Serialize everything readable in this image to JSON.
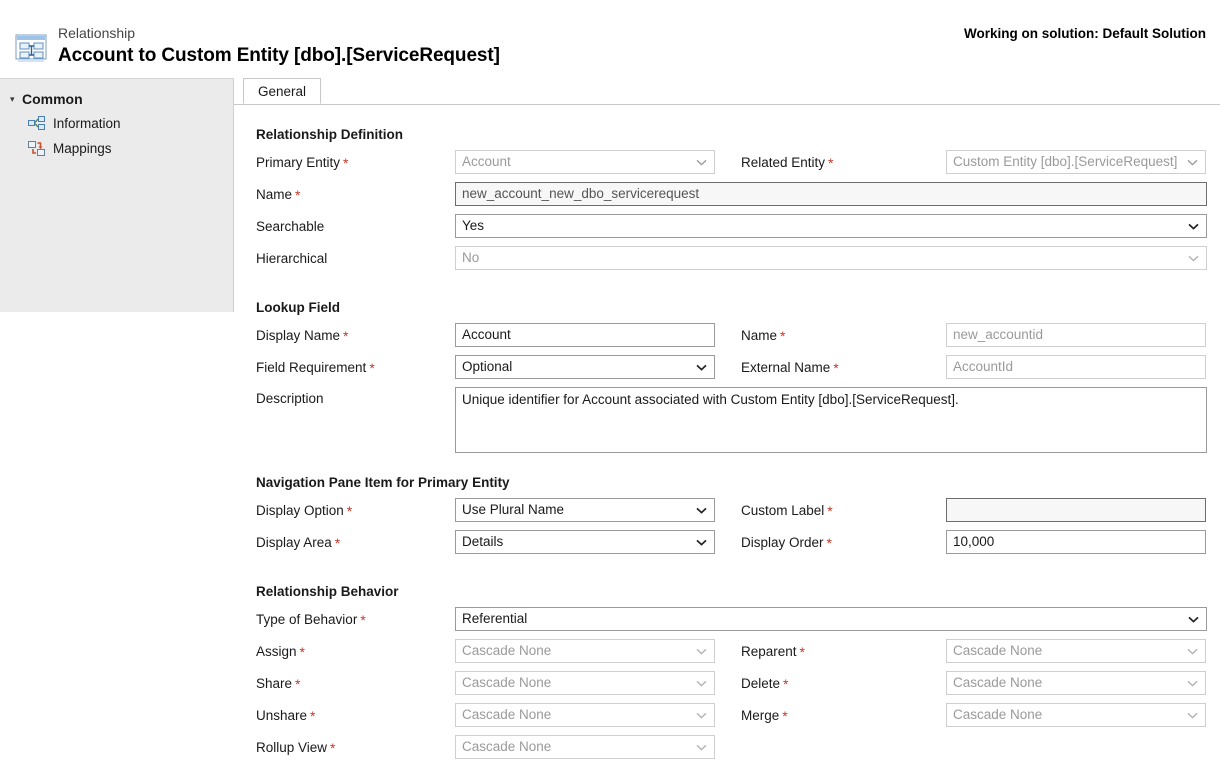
{
  "header": {
    "kicker": "Relationship",
    "title": "Account to Custom Entity [dbo].[ServiceRequest]",
    "solution_note": "Working on solution: Default Solution",
    "icon": "relationship-icon"
  },
  "sidebar": {
    "group_label": "Common",
    "group_icon": "triangle-collapse-icon",
    "items": [
      {
        "label": "Information",
        "icon": "information-relationship-icon"
      },
      {
        "label": "Mappings",
        "icon": "mappings-icon"
      }
    ]
  },
  "tabs": [
    {
      "label": "General",
      "active": true
    }
  ],
  "sections": {
    "relationship_definition": {
      "title": "Relationship Definition",
      "primary_entity": {
        "label": "Primary Entity",
        "required": true,
        "value": "Account",
        "disabled": true,
        "control": "dropdown"
      },
      "related_entity": {
        "label": "Related Entity",
        "required": true,
        "value": "Custom Entity [dbo].[ServiceRequest]",
        "disabled": true,
        "control": "dropdown"
      },
      "name": {
        "label": "Name",
        "required": true,
        "value": "new_account_new_dbo_servicerequest",
        "readonly": true,
        "control": "text"
      },
      "searchable": {
        "label": "Searchable",
        "required": false,
        "value": "Yes",
        "disabled": false,
        "control": "dropdown"
      },
      "hierarchical": {
        "label": "Hierarchical",
        "required": false,
        "value": "No",
        "disabled": true,
        "control": "dropdown"
      }
    },
    "lookup_field": {
      "title": "Lookup Field",
      "display_name": {
        "label": "Display Name",
        "required": true,
        "value": "Account",
        "disabled": false,
        "control": "text"
      },
      "name": {
        "label": "Name",
        "required": true,
        "value": "new_accountid",
        "disabled": true,
        "control": "text"
      },
      "field_requirement": {
        "label": "Field Requirement",
        "required": true,
        "value": "Optional",
        "disabled": false,
        "control": "dropdown"
      },
      "external_name": {
        "label": "External Name",
        "required": true,
        "value": "AccountId",
        "disabled": true,
        "control": "text"
      },
      "description": {
        "label": "Description",
        "required": false,
        "value": "Unique identifier for Account associated with Custom Entity [dbo].[ServiceRequest].",
        "control": "textarea"
      }
    },
    "navigation_pane": {
      "title": "Navigation Pane Item for Primary Entity",
      "display_option": {
        "label": "Display Option",
        "required": true,
        "value": "Use Plural Name",
        "disabled": false,
        "control": "dropdown"
      },
      "custom_label": {
        "label": "Custom Label",
        "required": true,
        "value": "",
        "readonly": true,
        "control": "text"
      },
      "display_area": {
        "label": "Display Area",
        "required": true,
        "value": "Details",
        "disabled": false,
        "control": "dropdown"
      },
      "display_order": {
        "label": "Display Order",
        "required": true,
        "value": "10,000",
        "disabled": false,
        "control": "text"
      }
    },
    "relationship_behavior": {
      "title": "Relationship Behavior",
      "type_of_behavior": {
        "label": "Type of Behavior",
        "required": true,
        "value": "Referential",
        "disabled": false,
        "control": "dropdown"
      },
      "assign": {
        "label": "Assign",
        "required": true,
        "value": "Cascade None",
        "disabled": true,
        "control": "dropdown"
      },
      "reparent": {
        "label": "Reparent",
        "required": true,
        "value": "Cascade None",
        "disabled": true,
        "control": "dropdown"
      },
      "share": {
        "label": "Share",
        "required": true,
        "value": "Cascade None",
        "disabled": true,
        "control": "dropdown"
      },
      "delete": {
        "label": "Delete",
        "required": true,
        "value": "Cascade None",
        "disabled": true,
        "control": "dropdown"
      },
      "unshare": {
        "label": "Unshare",
        "required": true,
        "value": "Cascade None",
        "disabled": true,
        "control": "dropdown"
      },
      "merge": {
        "label": "Merge",
        "required": true,
        "value": "Cascade None",
        "disabled": true,
        "control": "dropdown"
      },
      "rollup_view": {
        "label": "Rollup View",
        "required": true,
        "value": "Cascade None",
        "disabled": true,
        "control": "dropdown"
      }
    }
  },
  "colors": {
    "required_asterisk": "#c03a2b",
    "sidebar_bg": "#ebebeb",
    "disabled_text": "#9a9a9a",
    "icon_blue": "#4a8fd4"
  }
}
